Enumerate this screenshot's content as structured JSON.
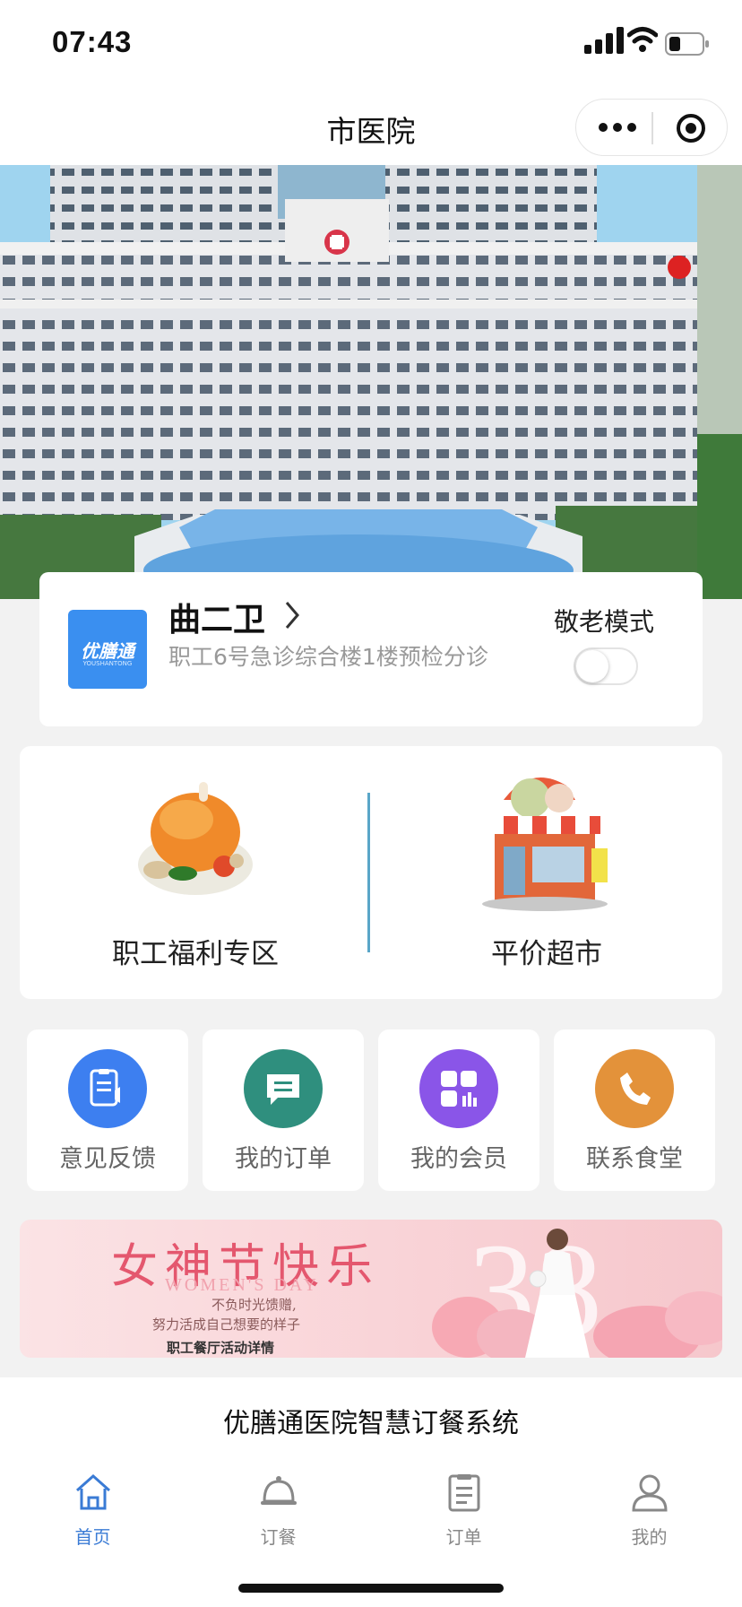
{
  "status": {
    "time": "07:43"
  },
  "header": {
    "title": "市医院"
  },
  "user_card": {
    "logo_text": "优膳通",
    "logo_sub": "YOUSHANTONG",
    "name": "曲二卫",
    "location": "职工6号急诊综合楼1楼预检分诊",
    "elder_mode_label": "敬老模式",
    "elder_mode_on": false
  },
  "main_zones": [
    {
      "label": "职工福利专区"
    },
    {
      "label": "平价超市"
    }
  ],
  "quick_actions": [
    {
      "label": "意见反馈",
      "icon": "feedback-icon",
      "color": "#3d7ff0"
    },
    {
      "label": "我的订单",
      "icon": "message-icon",
      "color": "#2f8f7e"
    },
    {
      "label": "我的会员",
      "icon": "member-grid-icon",
      "color": "#8a55e8"
    },
    {
      "label": "联系食堂",
      "icon": "phone-icon",
      "color": "#e3923a"
    }
  ],
  "promo": {
    "title": "女神节快乐",
    "english": "WOMEN'S DAY",
    "line1": "不负时光馈赠,",
    "line2": "努力活成自己想要的样子",
    "link": "职工餐厅活动详情",
    "number": "38"
  },
  "footer": {
    "system_name": "优膳通医院智慧订餐系统"
  },
  "tabs": [
    {
      "label": "首页",
      "icon": "home-icon",
      "active": true
    },
    {
      "label": "订餐",
      "icon": "cloche-icon",
      "active": false
    },
    {
      "label": "订单",
      "icon": "clipboard-icon",
      "active": false
    },
    {
      "label": "我的",
      "icon": "person-icon",
      "active": false
    }
  ],
  "colors": {
    "accent": "#3a7bd5",
    "divider": "#5aa6c8"
  }
}
